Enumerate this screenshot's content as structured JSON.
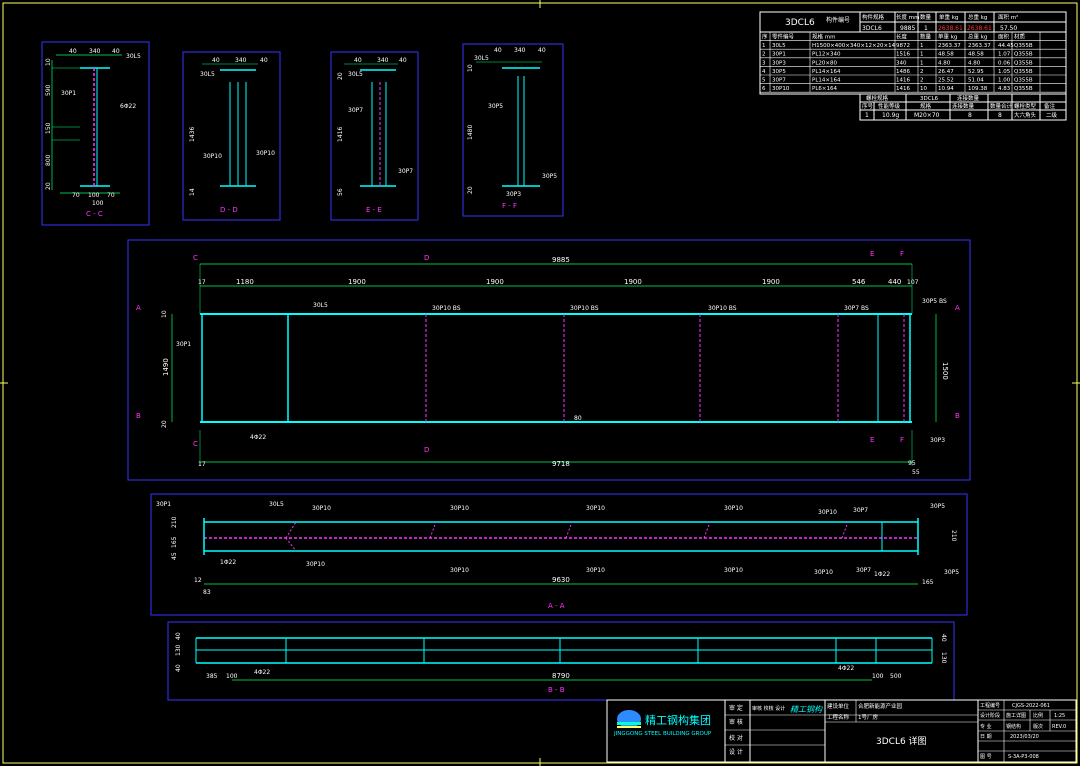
{
  "drawing_id": "3DCL6",
  "bom_header": {
    "col_member": "构件编号",
    "col_size": "构件规格",
    "col_len": "长度 mm",
    "col_qty": "数量",
    "col_unit_w": "单重 kg",
    "col_total_w": "总重 kg",
    "col_area": "面积 m²"
  },
  "member_row": {
    "id": "3DCL6",
    "len": "9885",
    "qty": "1",
    "unit_w": "2638.61",
    "total_w": "2638.61",
    "area": "57.50"
  },
  "parts_header": {
    "no": "序",
    "part": "零件编号",
    "spec": "规格 mm",
    "len": "长度",
    "qty": "数量",
    "unit_w": "单重 kg",
    "total_w": "总重 kg",
    "area": "面积",
    "mat": "材质"
  },
  "parts": [
    {
      "no": "1",
      "part": "30L5",
      "spec": "H1500×400×340×12×20×14",
      "len": "9872",
      "qty": "1",
      "unit_w": "2363.37",
      "total_w": "2363.37",
      "area": "44.45",
      "mat": "Q355B"
    },
    {
      "no": "2",
      "part": "30P1",
      "spec": "PL12×340",
      "len": "1516",
      "qty": "1",
      "unit_w": "48.58",
      "total_w": "48.58",
      "area": "1.07",
      "mat": "Q355B"
    },
    {
      "no": "3",
      "part": "30P3",
      "spec": "PL20×80",
      "len": "340",
      "qty": "1",
      "unit_w": "4.80",
      "total_w": "4.80",
      "area": "0.06",
      "mat": "Q355B"
    },
    {
      "no": "4",
      "part": "30P5",
      "spec": "PL14×164",
      "len": "1486",
      "qty": "2",
      "unit_w": "26.47",
      "total_w": "52.95",
      "area": "1.05",
      "mat": "Q355B"
    },
    {
      "no": "5",
      "part": "30P7",
      "spec": "PL14×164",
      "len": "1416",
      "qty": "2",
      "unit_w": "25.52",
      "total_w": "51.04",
      "area": "1.00",
      "mat": "Q355B"
    },
    {
      "no": "6",
      "part": "30P10",
      "spec": "PL6×164",
      "len": "1416",
      "qty": "10",
      "unit_w": "10.94",
      "total_w": "109.38",
      "area": "4.83",
      "mat": "Q355B"
    }
  ],
  "bolt_header": {
    "title1": "螺栓规格",
    "title2": "3DCL6",
    "title3": "连接数量",
    "col_no": "序号",
    "col_grade": "性能等级",
    "col_spec": "规格",
    "col_cnt": "连接数量",
    "col_total": "数量合计",
    "col_type": "螺栓类型",
    "col_note": "备注"
  },
  "bolt_row": {
    "no": "1",
    "grade": "10.9g",
    "spec": "M20×70",
    "cnt": "8",
    "total": "8",
    "type": "大六角头",
    "note": "二级"
  },
  "sections": {
    "cc": "C - C",
    "dd": "D - D",
    "ee": "E - E",
    "ff": "F - F",
    "aa": "A - A",
    "bb": "B - B"
  },
  "dims": {
    "total_len": "9885",
    "bottom_len": "9718",
    "aa_len": "9630",
    "bb_len": "8790",
    "s1180": "1180",
    "s1900": "1900",
    "s546": "546",
    "s440": "440",
    "s107": "107",
    "h1490": "1490",
    "h1500": "1500",
    "d40": "40",
    "d340": "340",
    "d70": "70",
    "d100": "100",
    "d590": "590",
    "d800": "800",
    "d150": "150",
    "d1436": "1436",
    "d1416": "1416",
    "d1480": "1480",
    "d10": "10",
    "d20": "20",
    "d14": "14",
    "d56": "56",
    "d17": "17",
    "d12": "12",
    "d83": "83",
    "d385": "385",
    "d500": "500",
    "d130": "130",
    "d45": "45",
    "d165": "165",
    "d210": "210",
    "d95": "95",
    "d55": "55",
    "d80": "80"
  },
  "tags": {
    "L5": "30L5",
    "P1": "30P1",
    "P3": "30P3",
    "P5": "30P5",
    "P7": "30P7",
    "P10": "30P10",
    "P10BS": "30P10 BS",
    "P7BS": "30P7 BS",
    "P5BS": "30P5 BS",
    "hole6": "6Φ22",
    "hole4": "4Φ22",
    "hole1": "1Φ22"
  },
  "section_marks": {
    "A": "A",
    "B": "B",
    "C": "C",
    "D": "D",
    "E": "E",
    "F": "F"
  },
  "title_block": {
    "company_cn": "精工钢构集团",
    "company_en": "JINGGONG STEEL BUILDING GROUP",
    "l_review": "审 定",
    "l_check": "审 核",
    "l_proof": "校 对",
    "l_design": "设 计",
    "review_val": "审核 校核 设计",
    "sign": "精工钢构",
    "l_project_unit": "建设单位",
    "project_unit": "合肥新能源产业园",
    "l_project_name": "工程名称",
    "project_name": "1号厂房",
    "drawing_title": "3DCL6 详图",
    "l_proj_no": "工程编号",
    "proj_no": "CJGS-2022-061",
    "l_phase": "设计阶段",
    "phase": "施工详图",
    "l_scale": "比例",
    "scale": "1:25",
    "l_spec": "专 业",
    "spec": "钢结构",
    "l_ver": "版次",
    "ver": "REV.0",
    "l_date": "日 期",
    "date": "2023/03/20",
    "l_dwgno": "图 号",
    "dwgno": "S-3A-P3-008"
  }
}
